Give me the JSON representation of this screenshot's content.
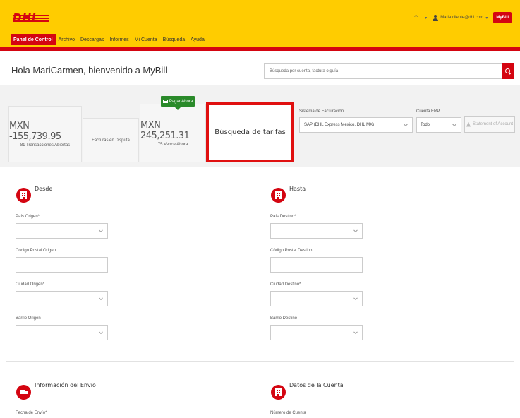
{
  "brand": {
    "logo_text": "DHL",
    "accent": "#d40511",
    "header_bg": "#ffcc00"
  },
  "header": {
    "user_email": "Maria.cliente@dhl.com",
    "app_badge": "MyBill"
  },
  "nav": {
    "items": [
      {
        "label": "Panel de Control",
        "active": true
      },
      {
        "label": "Archivo"
      },
      {
        "label": "Descargas"
      },
      {
        "label": "Informes"
      },
      {
        "label": "Mi Cuenta"
      },
      {
        "label": "Búsqueda"
      },
      {
        "label": "Ayuda"
      }
    ]
  },
  "greeting": "Hola MariCarmen, bienvenido a MyBill",
  "search": {
    "placeholder": "Búsqueda por cuenta, factura o guía"
  },
  "summary": {
    "open": {
      "amount": "MXN -155,739.95",
      "sub": "81 Transacciones Abiertas"
    },
    "dispute": {
      "label": "Facturas en Disputa"
    },
    "due": {
      "amount": "MXN 245,251.31",
      "sub": "75 Vence Ahora",
      "pay_label": "Pagar Ahora"
    },
    "rates": {
      "label": "Búsqueda de tarifas"
    }
  },
  "filters": {
    "billing_label": "Sistema de Facturación",
    "billing_value": "SAP (DHL Express Mexico, DHL MX)",
    "erp_label": "Cuenta ERP",
    "erp_value": "Todo",
    "statement_label": "Statement of Account"
  },
  "from": {
    "title": "Desde",
    "country_label": "País Origen*",
    "postal_label": "Código Postal Origen",
    "city_label": "Ciudad Origen*",
    "district_label": "Barrio Origen"
  },
  "to": {
    "title": "Hasta",
    "country_label": "País Destino*",
    "postal_label": "Código Postal Destino",
    "city_label": "Ciudad Destino*",
    "district_label": "Barrio Destino"
  },
  "shipment": {
    "title": "Información del Envío",
    "date_label": "Fecha de Envío*"
  },
  "account": {
    "title": "Datos de la Cuenta",
    "number_label": "Número de Cuenta"
  }
}
